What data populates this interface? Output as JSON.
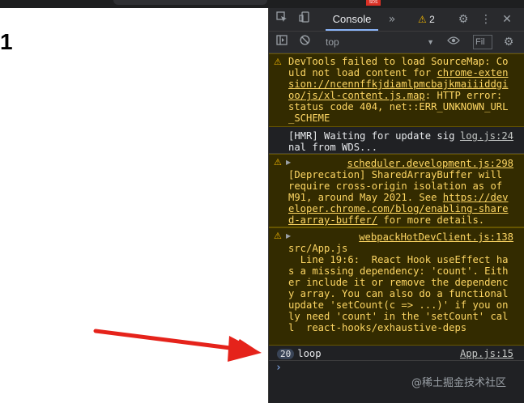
{
  "page": {
    "counter": "1"
  },
  "topbar": {
    "badge": "SOS"
  },
  "devtools": {
    "tab": "Console",
    "more_tabs": "»",
    "warning_count": "2",
    "context": "top",
    "filter_placeholder": "Fil",
    "messages": {
      "m1": {
        "text_a": "DevTools failed to load SourceMap: Could not load content for ",
        "link": "chrome-extension://ncennffkjdiamlpmcbajkmaiiiddgioo/js/xl-content.js.map",
        "text_b": ": HTTP error: status code 404, net::ERR_UNKNOWN_URL_SCHEME"
      },
      "m2": {
        "text": "[HMR] Waiting for update signal from WDS...",
        "source": "log.js:24"
      },
      "m3": {
        "source": "scheduler.development.js:298",
        "text_a": "[Deprecation] SharedArrayBuffer will require cross-origin isolation as of M91, around May 2021. See ",
        "link": "https://developer.chrome.com/blog/enabling-shared-array-buffer/",
        "text_b": " for more details."
      },
      "m4": {
        "source": "webpackHotDevClient.js:138",
        "text": "src/App.js\n  Line 19:6:  React Hook useEffect has a missing dependency: 'count'. Either include it or remove the dependency array. You can also do a functional update 'setCount(c => ...)' if you only need 'count' in the 'setCount' call  react-hooks/exhaustive-deps"
      },
      "m5": {
        "count": "20",
        "text": "loop",
        "source": "App.js:15"
      }
    }
  },
  "watermark": "@稀土掘金技术社区",
  "colors": {
    "warning_bg": "#332b00",
    "warning_text": "#fdd663",
    "arrow": "#e5231b",
    "accent": "#8ab4f8"
  }
}
